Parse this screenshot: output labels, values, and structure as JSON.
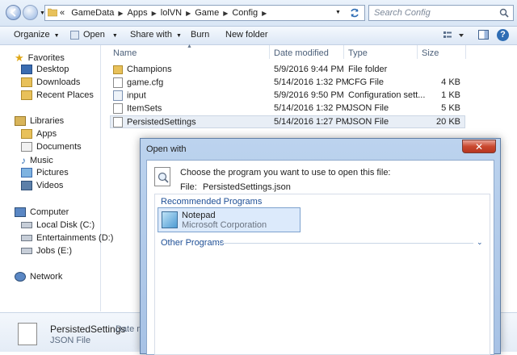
{
  "address": {
    "breadcrumb_prefix": "«",
    "crumbs": [
      "GameData",
      "Apps",
      "lolVN",
      "Game",
      "Config"
    ],
    "search_placeholder": "Search Config"
  },
  "toolbar": {
    "organize": "Organize",
    "open": "Open",
    "share_with": "Share with",
    "burn": "Burn",
    "new_folder": "New folder"
  },
  "nav": {
    "favorites": "Favorites",
    "desktop": "Desktop",
    "downloads": "Downloads",
    "recent_places": "Recent Places",
    "libraries": "Libraries",
    "apps": "Apps",
    "documents": "Documents",
    "music": "Music",
    "pictures": "Pictures",
    "videos": "Videos",
    "computer": "Computer",
    "local_disk": "Local Disk (C:)",
    "entertainments": "Entertainments (D:)",
    "jobs": "Jobs (E:)",
    "network": "Network"
  },
  "columns": {
    "name": "Name",
    "date": "Date modified",
    "type": "Type",
    "size": "Size"
  },
  "files": [
    {
      "name": "Champions",
      "date": "5/9/2016 9:44 PM",
      "type": "File folder",
      "size": ""
    },
    {
      "name": "game.cfg",
      "date": "5/14/2016 1:32 PM",
      "type": "CFG File",
      "size": "4 KB"
    },
    {
      "name": "input",
      "date": "5/9/2016 9:50 PM",
      "type": "Configuration sett...",
      "size": "1 KB"
    },
    {
      "name": "ItemSets",
      "date": "5/14/2016 1:32 PM",
      "type": "JSON File",
      "size": "5 KB"
    },
    {
      "name": "PersistedSettings",
      "date": "5/14/2016 1:27 PM",
      "type": "JSON File",
      "size": "20 KB"
    }
  ],
  "details": {
    "name": "PersistedSettings",
    "date_label": "Date m",
    "type": "JSON File"
  },
  "dialog": {
    "title": "Open with",
    "close": "✕",
    "prompt": "Choose the program you want to use to open this file:",
    "file_label": "File:",
    "file_name": "PersistedSettings.json",
    "recommended": "Recommended Programs",
    "notepad_name": "Notepad",
    "notepad_vendor": "Microsoft Corporation",
    "other": "Other Programs"
  }
}
